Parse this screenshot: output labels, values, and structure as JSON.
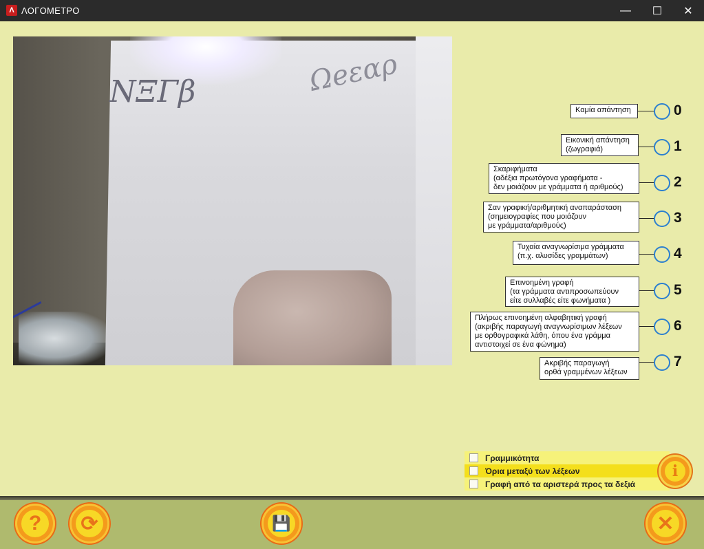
{
  "window": {
    "title": "ΛΟΓΟΜΕΤΡΟ",
    "app_icon_glyph": "Λ",
    "minimize_glyph": "—",
    "maximize_glyph": "☐",
    "close_glyph": "✕"
  },
  "camera": {
    "scribble_left": "ΝΞΓβ",
    "scribble_right": "Ωeεαρ"
  },
  "options": [
    {
      "num": "0",
      "label": "Καμία απάντηση"
    },
    {
      "num": "1",
      "label": "Εικονική απάντηση\n(ζωγραφιά)"
    },
    {
      "num": "2",
      "label": "Σκαριφήματα\n(αδέξια πρωτόγονα γραφήματα -\nδεν μοιάζουν με γράμματα ή αριθμούς)"
    },
    {
      "num": "3",
      "label": "Σαν γραφική/αριθμητική αναπαράσταση\n(σημειογραφίες που μοιάζουν\nμε γράμματα/αριθμούς)"
    },
    {
      "num": "4",
      "label": "Τυχαία αναγνωρίσιμα γράμματα\n(π.χ. αλυσίδες γραμμάτων)"
    },
    {
      "num": "5",
      "label": "Επινοημένη γραφή\n(τα γράμματα αντιπροσωπεύουν\nείτε συλλαβές είτε φωνήματα )"
    },
    {
      "num": "6",
      "label": "Πλήρως επινοημένη αλφαβητική γραφή\n(ακριβής παραγωγή αναγνωρίσιμων λέξεων\nμε ορθογραφικά λάθη, όπου ένα γράμμα\nαντιστοιχεί σε ένα φώνημα)"
    },
    {
      "num": "7",
      "label": "Ακριβής παραγωγή\nορθά γραμμένων λέξεων"
    }
  ],
  "checklist": [
    {
      "label": "Γραμμικότητα"
    },
    {
      "label": "Όρια μεταξύ των λέξεων"
    },
    {
      "label": "Γραφή από τα αριστερά προς τα δεξιά"
    }
  ],
  "buttons": {
    "info_glyph": "i",
    "help_glyph": "?",
    "refresh_glyph": "⟳",
    "save_glyph": "💾",
    "exit_glyph": "✕"
  }
}
